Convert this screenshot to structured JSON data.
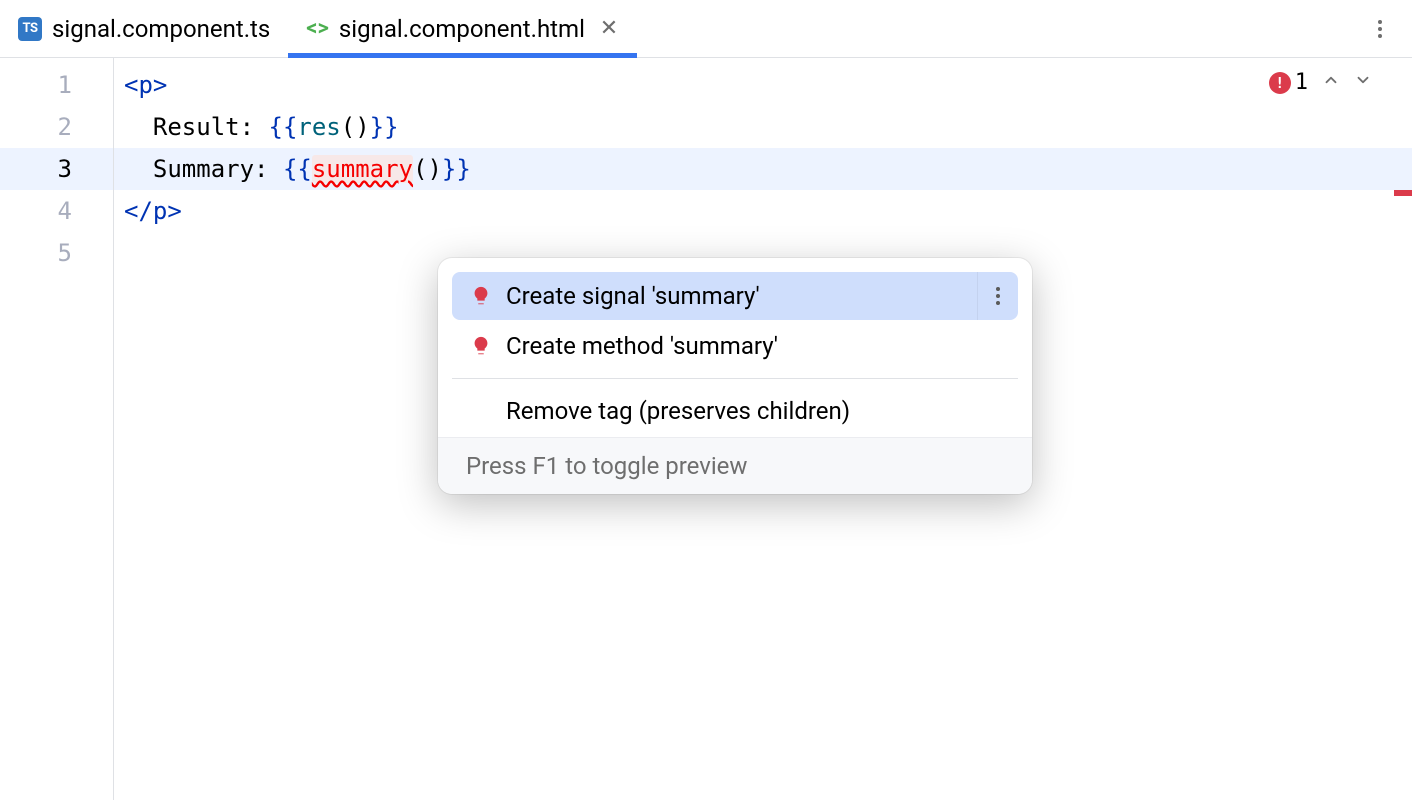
{
  "tabs": [
    {
      "label": "signal.component.ts",
      "icon": "ts",
      "active": false,
      "closable": false
    },
    {
      "label": "signal.component.html",
      "icon": "html",
      "active": true,
      "closable": true
    }
  ],
  "gutter": {
    "lines": [
      "1",
      "2",
      "3",
      "4",
      "5"
    ],
    "current": 3
  },
  "code": {
    "line1": {
      "open": "<",
      "tag": "p",
      "close": ">"
    },
    "line2": {
      "text": "Result: ",
      "lbrace": "{{",
      "fn": "res",
      "parens": "()",
      "rbrace": "}}"
    },
    "line3": {
      "text": "Summary: ",
      "lbrace": "{{",
      "err": "summary",
      "parens": "()",
      "rbrace": "}}"
    },
    "line4": {
      "open": "</",
      "tag": "p",
      "close": ">"
    }
  },
  "inspection": {
    "error_count": "1"
  },
  "popup": {
    "items": [
      {
        "label": "Create signal 'summary'",
        "icon": "bulb-red",
        "selected": true,
        "more": true
      },
      {
        "label": "Create method 'summary'",
        "icon": "bulb-red",
        "selected": false,
        "more": false
      }
    ],
    "extra": {
      "label": "Remove tag (preserves children)"
    },
    "footer": "Press F1 to toggle preview"
  }
}
